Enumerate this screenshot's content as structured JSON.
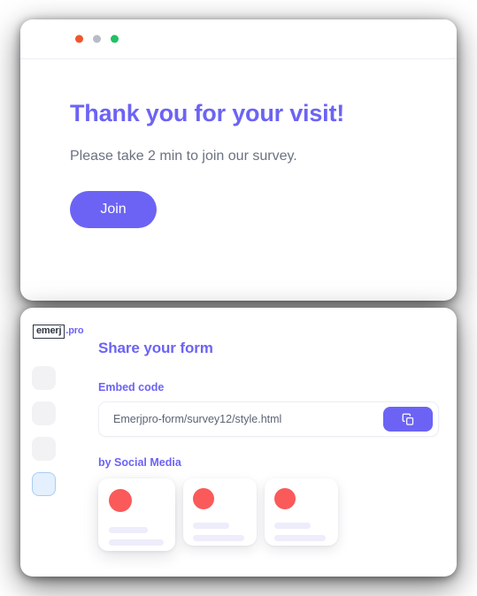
{
  "theme": {
    "accent": "#6c63f5",
    "accent_text": "#6c63f5",
    "heading_color": "#6c63f5",
    "body_text": "#6b7280",
    "coral": "#fa5a5a",
    "placeholder_line": "#ededfb",
    "sidebar_idle": "#f2f2f4",
    "sidebar_active_fill": "#e4f0fd",
    "sidebar_active_border": "#a9cdf3",
    "panel_bg": "#ffffff",
    "input_border": "#eceef4"
  },
  "browser_window": {
    "name": "browser-preview",
    "traffic_lights": [
      {
        "name": "close-dot",
        "color": "#f2552c"
      },
      {
        "name": "minimize-dot",
        "color": "#b7bcc6"
      },
      {
        "name": "maximize-dot",
        "color": "#23c065"
      }
    ],
    "page": {
      "title": "Thank you for your visit!",
      "subtitle": "Please take 2 min to join our survey.",
      "cta_label": "Join"
    }
  },
  "app_window": {
    "logo": {
      "mark": "emerj",
      "tld": ".pro"
    },
    "sidebar": {
      "items": [
        {
          "name": "sidebar-item-1",
          "active": false
        },
        {
          "name": "sidebar-item-2",
          "active": false
        },
        {
          "name": "sidebar-item-3",
          "active": false
        },
        {
          "name": "sidebar-item-4",
          "active": true
        }
      ]
    },
    "title": "Share your form",
    "embed": {
      "label": "Embed code",
      "value": "Emerjpro-form/survey12/style.html",
      "placeholder": "Emerjpro-form/survey12/style.html",
      "copy_icon": "copy-icon"
    },
    "social": {
      "label": "by Social Media",
      "cards": [
        {
          "name": "social-card-1",
          "avatar_icon": "avatar-circle-icon"
        },
        {
          "name": "social-card-2",
          "avatar_icon": "avatar-circle-icon"
        },
        {
          "name": "social-card-3",
          "avatar_icon": "avatar-circle-icon"
        }
      ]
    }
  }
}
